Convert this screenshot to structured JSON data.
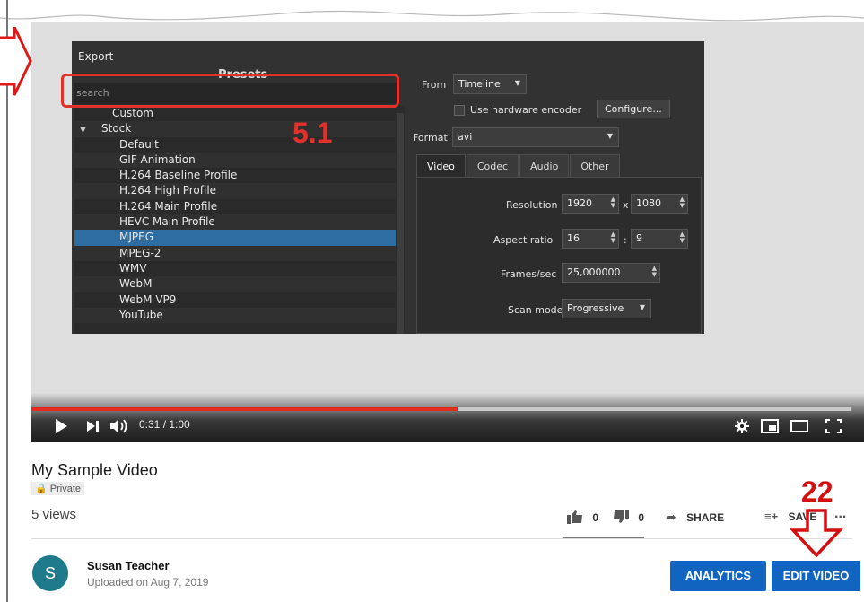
{
  "export_dialog": {
    "title": "Export",
    "presets_title": "Presets",
    "search_placeholder": "search",
    "tree": [
      {
        "label": "Custom",
        "level": 0
      },
      {
        "label": "Stock",
        "level": 0,
        "expanded": true
      },
      {
        "label": "Default",
        "level": 1
      },
      {
        "label": "GIF Animation",
        "level": 1
      },
      {
        "label": "H.264 Baseline Profile",
        "level": 1
      },
      {
        "label": "H.264 High Profile",
        "level": 1
      },
      {
        "label": "H.264 Main Profile",
        "level": 1
      },
      {
        "label": "HEVC Main Profile",
        "level": 1
      },
      {
        "label": "MJPEG",
        "level": 1,
        "selected": true
      },
      {
        "label": "MPEG-2",
        "level": 1
      },
      {
        "label": "WMV",
        "level": 1
      },
      {
        "label": "WebM",
        "level": 1
      },
      {
        "label": "WebM VP9",
        "level": 1
      },
      {
        "label": "YouTube",
        "level": 1
      }
    ],
    "from_label": "From",
    "from_value": "Timeline",
    "hw_encoder_label": "Use hardware encoder",
    "configure_label": "Configure...",
    "format_label": "Format",
    "format_value": "avi",
    "tabs": [
      "Video",
      "Codec",
      "Audio",
      "Other"
    ],
    "resolution_label": "Resolution",
    "resolution_w": "1920",
    "resolution_x": "x",
    "resolution_h": "1080",
    "aspect_label": "Aspect ratio",
    "aspect_w": "16",
    "aspect_sep": ":",
    "aspect_h": "9",
    "fps_label": "Frames/sec",
    "fps_value": "25,000000",
    "scan_label": "Scan mode",
    "scan_value": "Progressive"
  },
  "annotations": {
    "step_a": "5.1",
    "step_b": "22"
  },
  "player": {
    "time": "0:31 / 1:00",
    "progress": 0.52,
    "colors": {
      "progress": "#e52a1f"
    }
  },
  "video": {
    "title": "My Sample Video",
    "privacy": "Private",
    "views": "5 views",
    "likes": "0",
    "dislikes": "0",
    "share_label": "SHARE",
    "save_label": "SAVE",
    "more_label": "..."
  },
  "channel": {
    "avatar_letter": "S",
    "name": "Susan Teacher",
    "uploaded": "Uploaded on Aug 7, 2019"
  },
  "buttons": {
    "analytics": "ANALYTICS",
    "edit_video": "EDIT VIDEO",
    "color": "#1165c1"
  }
}
